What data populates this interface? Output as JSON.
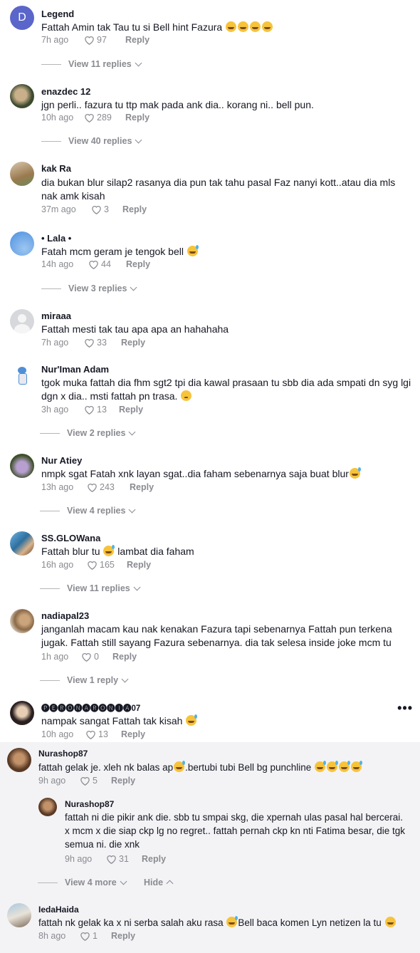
{
  "comments": [
    {
      "user": "Legend",
      "text": "Fattah Amin tak Tau tu si Bell hint Fazura",
      "time": "7h ago",
      "likes": "97",
      "reply": "Reply",
      "replies": "View 11 replies"
    },
    {
      "user": "enazdec 12",
      "text": "jgn perli.. fazura tu ttp mak pada ank dia.. korang ni.. bell pun.",
      "time": "10h ago",
      "likes": "289",
      "reply": "Reply",
      "replies": "View 40 replies"
    },
    {
      "user": "kak Ra",
      "text": "dia bukan blur silap2 rasanya dia pun tak tahu pasal Faz nanyi kott..atau dia mls nak amk kisah",
      "time": "37m ago",
      "likes": "3",
      "reply": "Reply"
    },
    {
      "user": "• Lala •",
      "text": "Fatah mcm geram je tengok bell",
      "time": "14h ago",
      "likes": "44",
      "reply": "Reply",
      "replies": "View 3 replies"
    },
    {
      "user": "miraaa",
      "text": "Fattah mesti tak tau apa apa an hahahaha",
      "time": "7h ago",
      "likes": "33",
      "reply": "Reply"
    },
    {
      "user": "Nur'Iman Adam",
      "text": "tgok muka fattah dia fhm sgt2 tpi dia kawal prasaan tu sbb dia ada smpati dn syg lgi dgn x dia.. msti fattah pn trasa.",
      "time": "3h ago",
      "likes": "13",
      "reply": "Reply",
      "replies": "View 2 replies"
    },
    {
      "user": "Nur Atiey",
      "text": "nmpk sgat Fatah xnk layan sgat..dia faham sebenarnya saja buat blur",
      "time": "13h ago",
      "likes": "243",
      "reply": "Reply",
      "replies": "View 4 replies"
    },
    {
      "user": "SS.GLOWana",
      "text": "Fattah blur tu",
      "text2": "lambat dia faham",
      "time": "16h ago",
      "likes": "165",
      "reply": "Reply",
      "replies": "View 11 replies"
    },
    {
      "user": "nadiapal23",
      "text": "janganlah macam kau nak kenakan Fazura tapi sebenarnya Fattah pun terkena jugak. Fattah still sayang Fazura sebenarnya. dia tak selesa inside joke mcm tu",
      "time": "1h ago",
      "likes": "0",
      "reply": "Reply",
      "replies": "View 1 reply"
    },
    {
      "user": "🅟🅔🅡🅞🅝🅐🅡🅞🅝🅘🅐07",
      "text": "nampak sangat Fattah tak kisah",
      "time": "10h ago",
      "likes": "13",
      "reply": "Reply"
    },
    {
      "user": "Nurashop87",
      "text": "fattah gelak je. xleh nk balas ap",
      "text2": ".bertubi tubi Bell bg punchline",
      "time": "9h ago",
      "likes": "5",
      "reply": "Reply"
    },
    {
      "user": "Nurashop87",
      "text": "fattah ni die pikir ank die. sbb tu smpai skg, die xpernah ulas pasal hal bercerai. x mcm x die siap ckp lg no regret.. fattah pernah ckp kn nti Fatima besar, die tgk semua ni. die xnk",
      "time": "9h ago",
      "likes": "31",
      "reply": "Reply"
    },
    {
      "user": "IedaHaida",
      "text": "fattah nk gelak ka x ni serba salah aku rasa",
      "text2": "Bell baca komen Lyn netizen la tu",
      "time": "8h ago",
      "likes": "1",
      "reply": "Reply"
    }
  ],
  "thread_controls": {
    "view_more": "View 4 more",
    "hide": "Hide"
  },
  "icons": {
    "like": "heart-outline-icon",
    "more": "more-options-icon"
  },
  "colors": {
    "text": "#161823",
    "muted": "#8a8b91",
    "highlight": "#f3f3f5"
  }
}
